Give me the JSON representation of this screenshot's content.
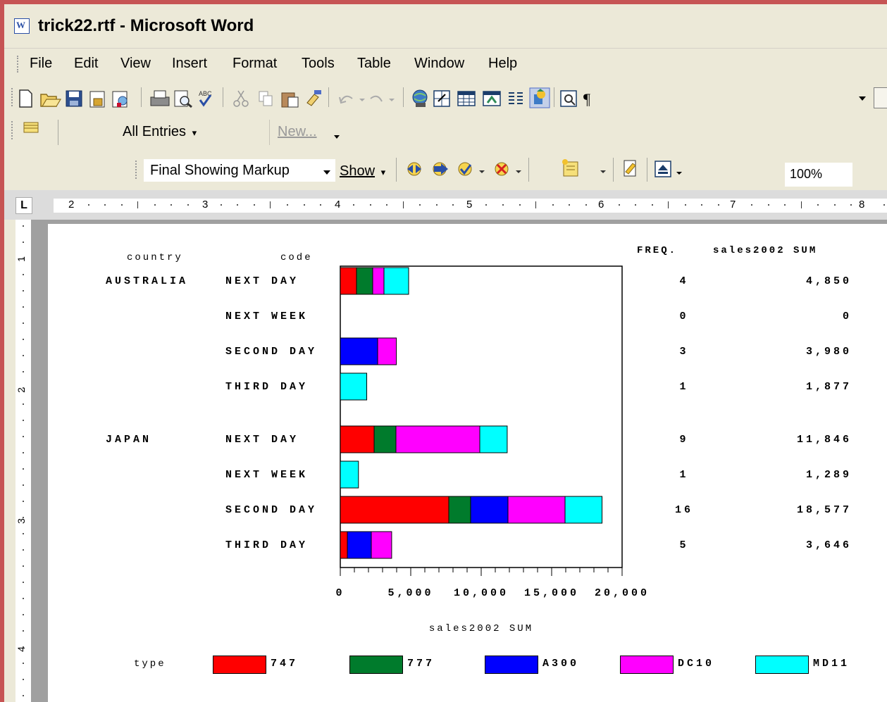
{
  "window": {
    "title": "trick22.rtf - Microsoft Word",
    "icon": "word-document-icon"
  },
  "menu": [
    "File",
    "Edit",
    "View",
    "Insert",
    "Format",
    "Tools",
    "Table",
    "Window",
    "Help"
  ],
  "toolbar": {
    "zoom": "100%",
    "icons": [
      "new-document-icon",
      "open-folder-icon",
      "save-icon",
      "permission-icon",
      "search-web-icon",
      "print-icon",
      "print-preview-icon",
      "spelling-icon",
      "cut-icon",
      "copy-icon",
      "paste-icon",
      "format-painter-icon",
      "undo-icon",
      "redo-icon",
      "hyperlink-icon",
      "tables-borders-icon",
      "insert-table-icon",
      "insert-excel-icon",
      "columns-icon",
      "drawing-icon",
      "document-map-icon",
      "show-formatting-icon"
    ]
  },
  "reviewing": {
    "entries_label": "All Entries",
    "new_label": "New...",
    "markup_mode": "Final Showing Markup",
    "show_label": "Show"
  },
  "ruler": {
    "labels": [
      "2",
      "3",
      "4",
      "5",
      "6",
      "7",
      "8"
    ],
    "vertical_labels": [
      "1",
      "2",
      "3",
      "4"
    ]
  },
  "report": {
    "col_country": "country",
    "col_code": "code",
    "col_freq": "FREQ.",
    "col_sum": "sales2002 SUM",
    "rows": [
      {
        "country": "AUSTRALIA",
        "code": "NEXT DAY",
        "freq": "4",
        "sum": "4,850"
      },
      {
        "country": "",
        "code": "NEXT WEEK",
        "freq": "0",
        "sum": "0"
      },
      {
        "country": "",
        "code": "SECOND DAY",
        "freq": "3",
        "sum": "3,980"
      },
      {
        "country": "",
        "code": "THIRD DAY",
        "freq": "1",
        "sum": "1,877"
      },
      {
        "country": "JAPAN",
        "code": "NEXT DAY",
        "freq": "9",
        "sum": "11,846"
      },
      {
        "country": "",
        "code": "NEXT WEEK",
        "freq": "1",
        "sum": "1,289"
      },
      {
        "country": "",
        "code": "SECOND DAY",
        "freq": "16",
        "sum": "18,577"
      },
      {
        "country": "",
        "code": "THIRD DAY",
        "freq": "5",
        "sum": "3,646"
      }
    ],
    "legend_title": "type"
  },
  "chart_data": {
    "type": "bar",
    "orientation": "horizontal",
    "stacked": true,
    "categories": [
      "AUSTRALIA NEXT DAY",
      "AUSTRALIA NEXT WEEK",
      "AUSTRALIA SECOND DAY",
      "AUSTRALIA THIRD DAY",
      "JAPAN NEXT DAY",
      "JAPAN NEXT WEEK",
      "JAPAN SECOND DAY",
      "JAPAN THIRD DAY"
    ],
    "series": [
      {
        "name": "747",
        "color": "#ff0000",
        "values": [
          1150,
          0,
          0,
          0,
          2400,
          0,
          7700,
          500
        ]
      },
      {
        "name": "777",
        "color": "#007b2c",
        "values": [
          1150,
          0,
          0,
          0,
          1550,
          0,
          1550,
          0
        ]
      },
      {
        "name": "A300",
        "color": "#0000ff",
        "values": [
          0,
          0,
          2650,
          0,
          0,
          0,
          2650,
          1700
        ]
      },
      {
        "name": "DC10",
        "color": "#ff00ff",
        "values": [
          800,
          0,
          1330,
          0,
          5950,
          0,
          4050,
          1446
        ]
      },
      {
        "name": "MD11",
        "color": "#00ffff",
        "values": [
          1750,
          0,
          0,
          1877,
          1946,
          1289,
          2627,
          0
        ]
      }
    ],
    "xlabel": "sales2002 SUM",
    "xlim": [
      0,
      20000
    ],
    "xticks": [
      0,
      5000,
      10000,
      15000,
      20000
    ],
    "xtick_labels": [
      "0",
      "5,000",
      "10,000",
      "15,000",
      "20,000"
    ],
    "legend_position": "bottom",
    "legend_title": "type"
  }
}
